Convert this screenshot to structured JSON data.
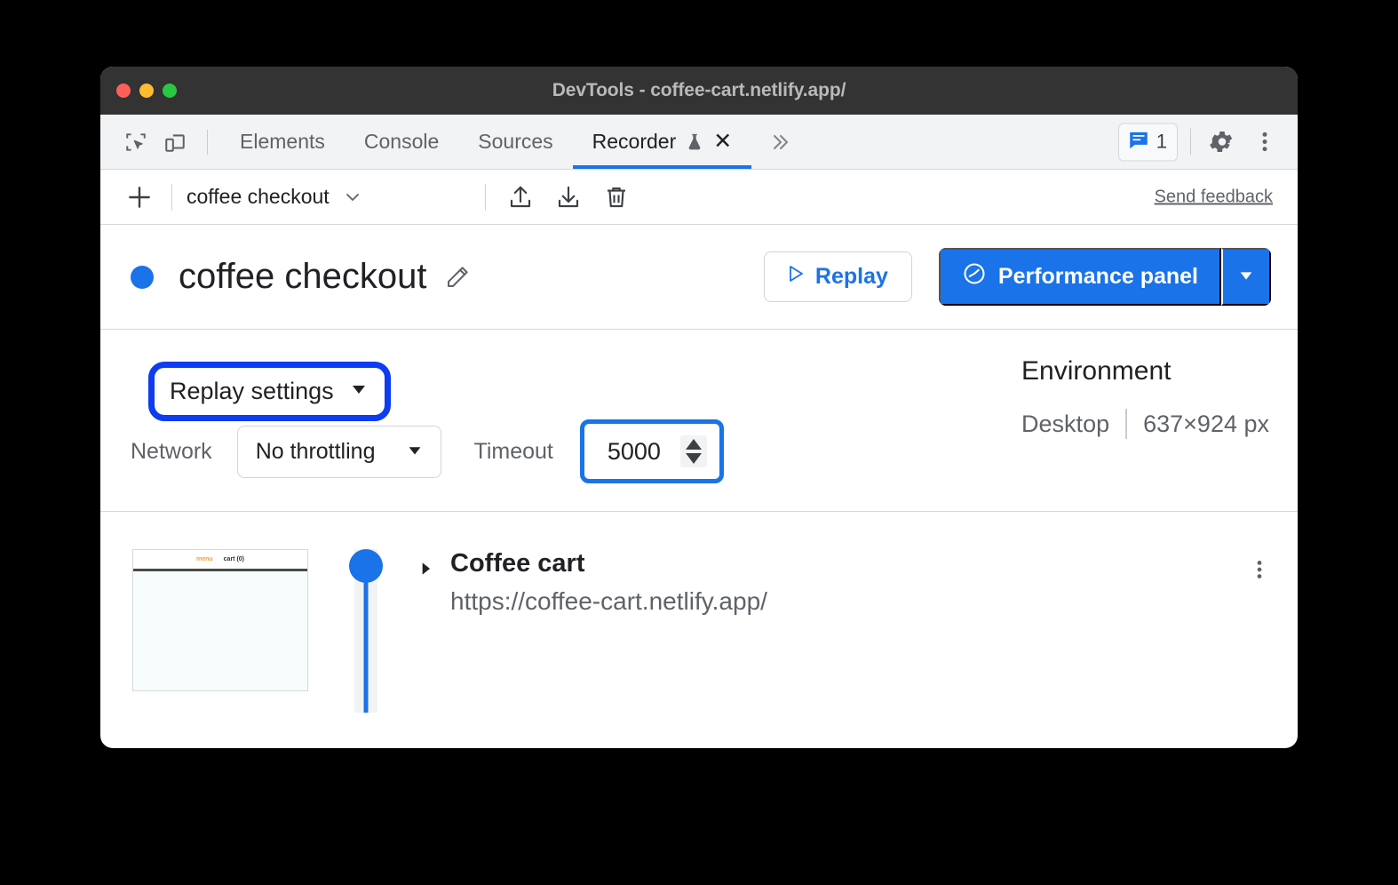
{
  "window": {
    "title": "DevTools - coffee-cart.netlify.app/",
    "traffic_lights": [
      "close",
      "minimize",
      "zoom"
    ]
  },
  "tabbar": {
    "inspect_icon": "inspect-element-icon",
    "device_icon": "device-toolbar-icon",
    "tabs": [
      {
        "label": "Elements",
        "active": false
      },
      {
        "label": "Console",
        "active": false
      },
      {
        "label": "Sources",
        "active": false
      },
      {
        "label": "Recorder",
        "active": true,
        "experimental": true,
        "closable": true
      }
    ],
    "more_tabs_icon": "chevron-double-right-icon",
    "close_tab_glyph": "✕",
    "issues": {
      "icon": "console-message-icon",
      "count": "1"
    },
    "settings_icon": "gear-icon",
    "menu_icon": "kebab-menu-icon"
  },
  "recorder_toolbar": {
    "add_icon": "plus-icon",
    "recording_name": "coffee checkout",
    "select_chevron_icon": "chevron-down-icon",
    "export_icon": "upload-icon",
    "import_icon": "download-icon",
    "delete_icon": "trash-icon",
    "feedback_label": "Send feedback"
  },
  "recording_header": {
    "status_dot_color": "#1a73e8",
    "title": "coffee checkout",
    "edit_icon": "pencil-icon",
    "replay_button": {
      "label": "Replay",
      "icon": "play-triangle-icon"
    },
    "performance_button": {
      "label": "Performance panel",
      "icon": "performance-gauge-icon",
      "caret_icon": "caret-down-icon"
    }
  },
  "replay_settings": {
    "toggle_label": "Replay settings",
    "toggle_caret_icon": "caret-down-icon",
    "highlight_color": "#0d3cf2",
    "network": {
      "label": "Network",
      "value": "No throttling",
      "caret_icon": "caret-down-icon"
    },
    "timeout": {
      "label": "Timeout",
      "value": "5000",
      "spinner_icon": "stepper-arrows-icon",
      "highlight_color": "#1a73e8"
    }
  },
  "environment": {
    "title": "Environment",
    "device": "Desktop",
    "viewport": "637×924 px"
  },
  "steps": [
    {
      "thumbnail": {
        "menu_text": "menu",
        "cart_text": "cart (0)"
      },
      "marker_color": "#1a73e8",
      "expander_icon": "triangle-right-icon",
      "title": "Coffee cart",
      "url": "https://coffee-cart.netlify.app/",
      "menu_icon": "kebab-menu-icon"
    }
  ]
}
